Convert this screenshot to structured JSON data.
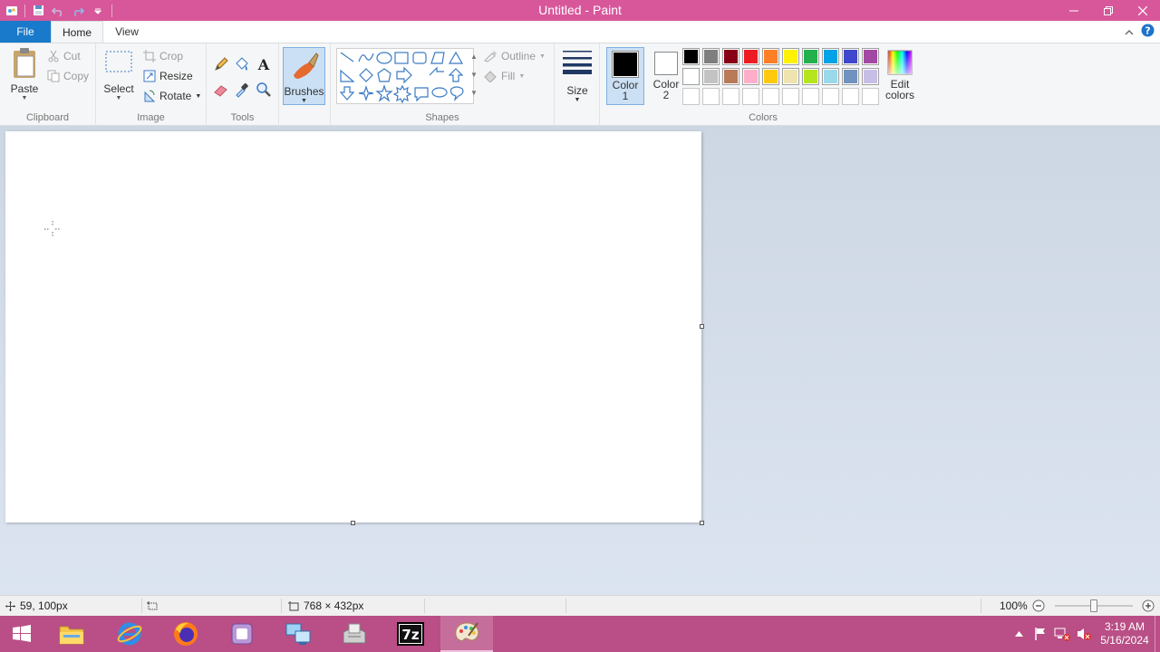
{
  "window": {
    "title": "Untitled - Paint"
  },
  "tabs": {
    "file": "File",
    "home": "Home",
    "view": "View"
  },
  "clipboard": {
    "paste": "Paste",
    "cut": "Cut",
    "copy": "Copy",
    "group": "Clipboard"
  },
  "image": {
    "select": "Select",
    "crop": "Crop",
    "resize": "Resize",
    "rotate": "Rotate",
    "group": "Image"
  },
  "tools": {
    "group": "Tools"
  },
  "brushes": {
    "label": "Brushes"
  },
  "shapes": {
    "outline": "Outline",
    "fill": "Fill",
    "group": "Shapes"
  },
  "size": {
    "label": "Size"
  },
  "colors": {
    "color1_line1": "Color",
    "color1_line2": "1",
    "color2_line1": "Color",
    "color2_line2": "2",
    "edit_line1": "Edit",
    "edit_line2": "colors",
    "group": "Colors",
    "color1_value": "#000000",
    "color2_value": "#ffffff",
    "palette_row1": [
      "#000000",
      "#7f7f7f",
      "#880015",
      "#ed1c24",
      "#ff7f27",
      "#fff200",
      "#22b14c",
      "#00a2e8",
      "#3f48cc",
      "#a349a4"
    ],
    "palette_row2": [
      "#ffffff",
      "#c3c3c3",
      "#b97a57",
      "#ffaec9",
      "#ffc90e",
      "#efe4b0",
      "#b5e61d",
      "#99d9ea",
      "#7092be",
      "#c8bfe7"
    ],
    "palette_row3": [
      "#ffffff",
      "#ffffff",
      "#ffffff",
      "#ffffff",
      "#ffffff",
      "#ffffff",
      "#ffffff",
      "#ffffff",
      "#ffffff",
      "#ffffff"
    ]
  },
  "status": {
    "cursor_pos": "59, 100px",
    "image_size": "768 × 432px",
    "zoom": "100%",
    "zoom_fraction": 0.5
  },
  "taskbar": {
    "time": "3:19 AM",
    "date": "5/16/2024"
  }
}
